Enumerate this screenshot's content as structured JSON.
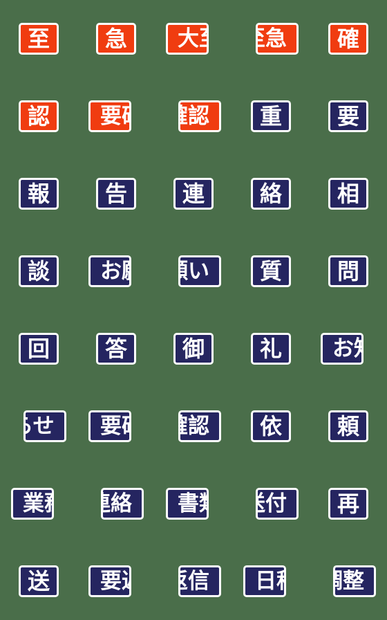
{
  "sheet": {
    "background_color": "#4a6e4a",
    "columns": 5,
    "rows": 8,
    "badge_colors": {
      "urgent": "#f03c10",
      "standard": "#252560",
      "border": "#ffffff",
      "text": "#ffffff"
    }
  },
  "badges": [
    {
      "text": "至",
      "color": "urgent",
      "chars": 1,
      "clip": "none",
      "pos": "c"
    },
    {
      "text": "急",
      "color": "urgent",
      "chars": 1,
      "clip": "none",
      "pos": "c"
    },
    {
      "text": "大至",
      "color": "urgent",
      "chars": 2,
      "clip": "right",
      "pos": "l"
    },
    {
      "text": "至急",
      "color": "urgent",
      "chars": 2,
      "clip": "left",
      "pos": "r"
    },
    {
      "text": "確",
      "color": "urgent",
      "chars": 1,
      "clip": "none",
      "pos": "c"
    },
    {
      "text": "認",
      "color": "urgent",
      "chars": 1,
      "clip": "none",
      "pos": "c"
    },
    {
      "text": "要確",
      "color": "urgent",
      "chars": 2,
      "clip": "right",
      "pos": "l"
    },
    {
      "text": "確認",
      "color": "urgent",
      "chars": 2,
      "clip": "left",
      "pos": "r"
    },
    {
      "text": "重",
      "color": "standard",
      "chars": 1,
      "clip": "none",
      "pos": "c"
    },
    {
      "text": "要",
      "color": "standard",
      "chars": 1,
      "clip": "none",
      "pos": "c"
    },
    {
      "text": "報",
      "color": "standard",
      "chars": 1,
      "clip": "none",
      "pos": "c"
    },
    {
      "text": "告",
      "color": "standard",
      "chars": 1,
      "clip": "none",
      "pos": "c"
    },
    {
      "text": "連",
      "color": "standard",
      "chars": 1,
      "clip": "none",
      "pos": "c"
    },
    {
      "text": "絡",
      "color": "standard",
      "chars": 1,
      "clip": "none",
      "pos": "c"
    },
    {
      "text": "相",
      "color": "standard",
      "chars": 1,
      "clip": "none",
      "pos": "c"
    },
    {
      "text": "談",
      "color": "standard",
      "chars": 1,
      "clip": "none",
      "pos": "c"
    },
    {
      "text": "お願",
      "color": "standard",
      "chars": 2,
      "clip": "right",
      "pos": "l"
    },
    {
      "text": "願い",
      "color": "standard",
      "chars": 2,
      "clip": "left",
      "pos": "r"
    },
    {
      "text": "質",
      "color": "standard",
      "chars": 1,
      "clip": "none",
      "pos": "c"
    },
    {
      "text": "問",
      "color": "standard",
      "chars": 1,
      "clip": "none",
      "pos": "c"
    },
    {
      "text": "回",
      "color": "standard",
      "chars": 1,
      "clip": "none",
      "pos": "c"
    },
    {
      "text": "答",
      "color": "standard",
      "chars": 1,
      "clip": "none",
      "pos": "c"
    },
    {
      "text": "御",
      "color": "standard",
      "chars": 1,
      "clip": "none",
      "pos": "c"
    },
    {
      "text": "礼",
      "color": "standard",
      "chars": 1,
      "clip": "none",
      "pos": "c"
    },
    {
      "text": "お知",
      "color": "standard",
      "chars": 2,
      "clip": "right",
      "pos": "l"
    },
    {
      "text": "らせ",
      "color": "standard",
      "chars": 2,
      "clip": "left",
      "pos": "r"
    },
    {
      "text": "要確",
      "color": "standard",
      "chars": 2,
      "clip": "right",
      "pos": "l"
    },
    {
      "text": "確認",
      "color": "standard",
      "chars": 2,
      "clip": "left",
      "pos": "r"
    },
    {
      "text": "依",
      "color": "standard",
      "chars": 1,
      "clip": "none",
      "pos": "c"
    },
    {
      "text": "頼",
      "color": "standard",
      "chars": 1,
      "clip": "none",
      "pos": "c"
    },
    {
      "text": "業務",
      "color": "standard",
      "chars": 2,
      "clip": "right",
      "pos": "l"
    },
    {
      "text": "連絡",
      "color": "standard",
      "chars": 2,
      "clip": "left",
      "pos": "r"
    },
    {
      "text": "書類",
      "color": "standard",
      "chars": 2,
      "clip": "right",
      "pos": "l"
    },
    {
      "text": "送付",
      "color": "standard",
      "chars": 2,
      "clip": "left",
      "pos": "r"
    },
    {
      "text": "再",
      "color": "standard",
      "chars": 1,
      "clip": "none",
      "pos": "c"
    },
    {
      "text": "送",
      "color": "standard",
      "chars": 1,
      "clip": "none",
      "pos": "c"
    },
    {
      "text": "要返",
      "color": "standard",
      "chars": 2,
      "clip": "right",
      "pos": "l"
    },
    {
      "text": "返信",
      "color": "standard",
      "chars": 2,
      "clip": "left",
      "pos": "r"
    },
    {
      "text": "日程",
      "color": "standard",
      "chars": 2,
      "clip": "right",
      "pos": "l"
    },
    {
      "text": "調整",
      "color": "standard",
      "chars": 2,
      "clip": "left",
      "pos": "r"
    }
  ]
}
